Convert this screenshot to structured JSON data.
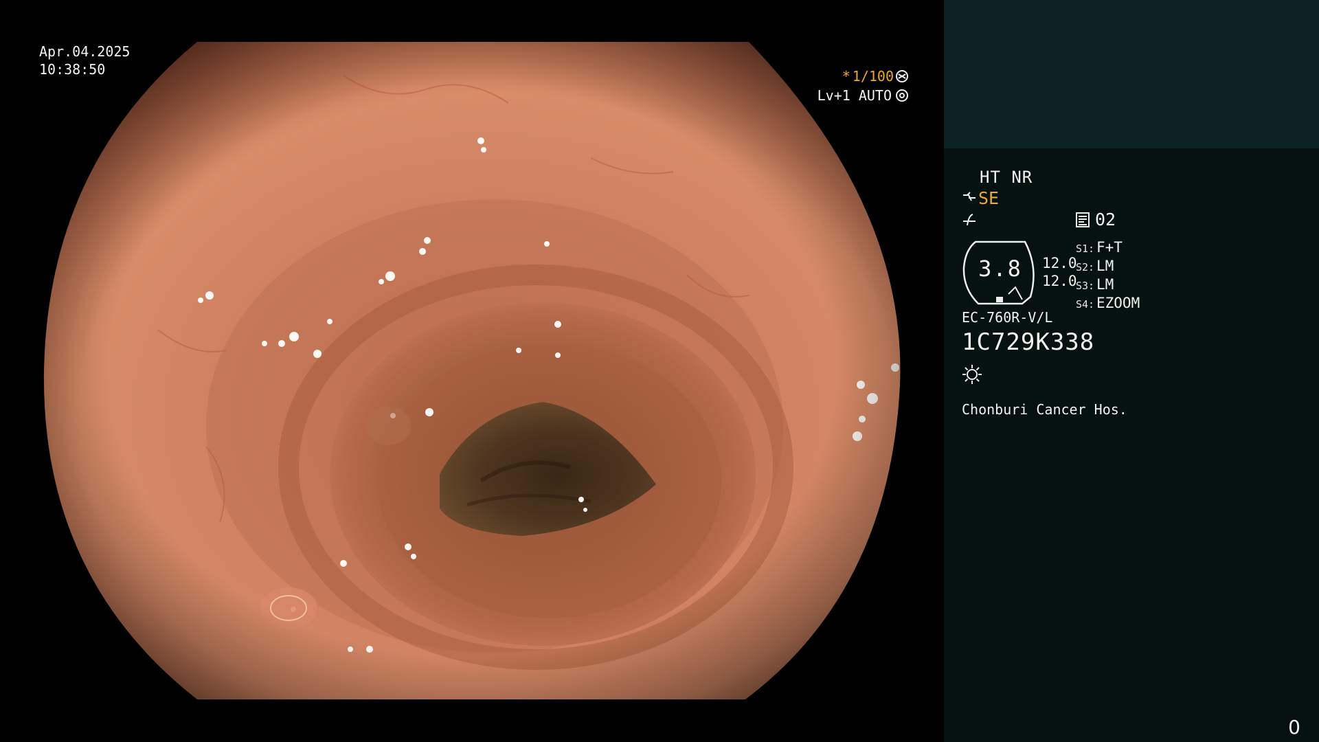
{
  "overlay": {
    "date": "Apr.04.2025",
    "time": "10:38:50",
    "shutter_star": "*",
    "shutter": "1/100",
    "level": "Lv+1 AUTO"
  },
  "info": {
    "ht_nr": "HT NR",
    "structure_enhance": "SE",
    "memo_number": "02",
    "gauge_value": "3.8",
    "gauge_upper": "12.0",
    "gauge_lower": "12.0",
    "switches": [
      {
        "key": "S1:",
        "value": "F+T"
      },
      {
        "key": "S2:",
        "value": "LM"
      },
      {
        "key": "S3:",
        "value": "LM"
      },
      {
        "key": "S4:",
        "value": "EZOOM"
      }
    ],
    "scope_model": "EC-760R-V/L",
    "scope_serial": "1C729K338",
    "hospital": "Chonburi Cancer Hos.",
    "counter": "0"
  },
  "colors": {
    "panel_bg": "#051210",
    "panel_top_band": "#0d2323",
    "accent": "#f0a830",
    "text": "#f2f2f2"
  },
  "icons": [
    "aperture-icon",
    "auto-iris-icon",
    "structure-icon",
    "curve-icon",
    "memo-icon",
    "light-icon"
  ]
}
